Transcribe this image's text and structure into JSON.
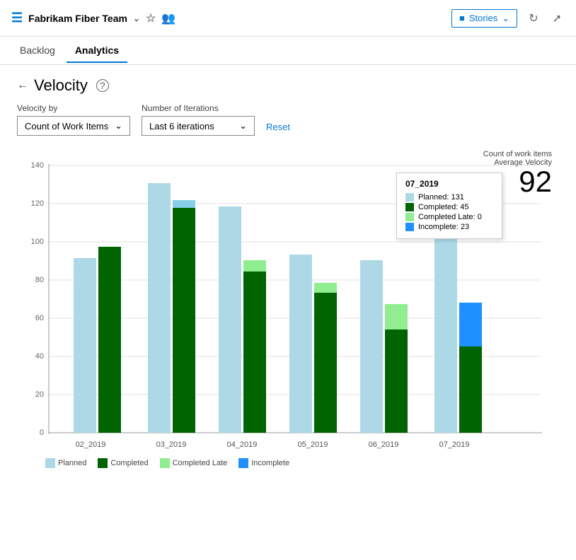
{
  "header": {
    "team_name": "Fabrikam Fiber Team",
    "stories_label": "Stories"
  },
  "nav": {
    "tabs": [
      {
        "id": "backlog",
        "label": "Backlog",
        "active": false
      },
      {
        "id": "analytics",
        "label": "Analytics",
        "active": true
      }
    ]
  },
  "page": {
    "title": "Velocity",
    "velocity_by_label": "Velocity by",
    "velocity_by_value": "Count of Work Items",
    "iterations_label": "Number of Iterations",
    "iterations_value": "Last 6 iterations",
    "reset_label": "Reset",
    "metric_label": "Count of work items",
    "metric_sublabel": "Average Velocity",
    "metric_value": "92"
  },
  "chart": {
    "y_max": 140,
    "y_ticks": [
      0,
      20,
      40,
      60,
      80,
      100,
      120,
      140
    ],
    "bars": [
      {
        "label": "02_2019",
        "planned": 91,
        "completed": 97,
        "completed_late": 0,
        "incomplete": 0
      },
      {
        "label": "03_2019",
        "planned": 130,
        "completed": 117,
        "completed_late": 0,
        "incomplete": 0
      },
      {
        "label": "04_2019",
        "planned": 118,
        "completed": 84,
        "completed_late": 90,
        "incomplete": 0
      },
      {
        "label": "05_2019",
        "planned": 93,
        "completed": 73,
        "completed_late": 78,
        "incomplete": 0
      },
      {
        "label": "06_2019",
        "planned": 90,
        "completed": 54,
        "completed_late": 67,
        "incomplete": 0
      },
      {
        "label": "07_2019",
        "planned": 131,
        "completed": 45,
        "completed_late": 0,
        "incomplete": 23
      }
    ],
    "tooltip": {
      "title": "07_2019",
      "planned": 131,
      "completed": 45,
      "completed_late": 0,
      "incomplete": 23
    },
    "legend": [
      {
        "label": "Planned",
        "color": "#add8e6"
      },
      {
        "label": "Completed",
        "color": "#006400"
      },
      {
        "label": "Completed Late",
        "color": "#90ee90"
      },
      {
        "label": "Incomplete",
        "color": "#1e90ff"
      }
    ]
  }
}
